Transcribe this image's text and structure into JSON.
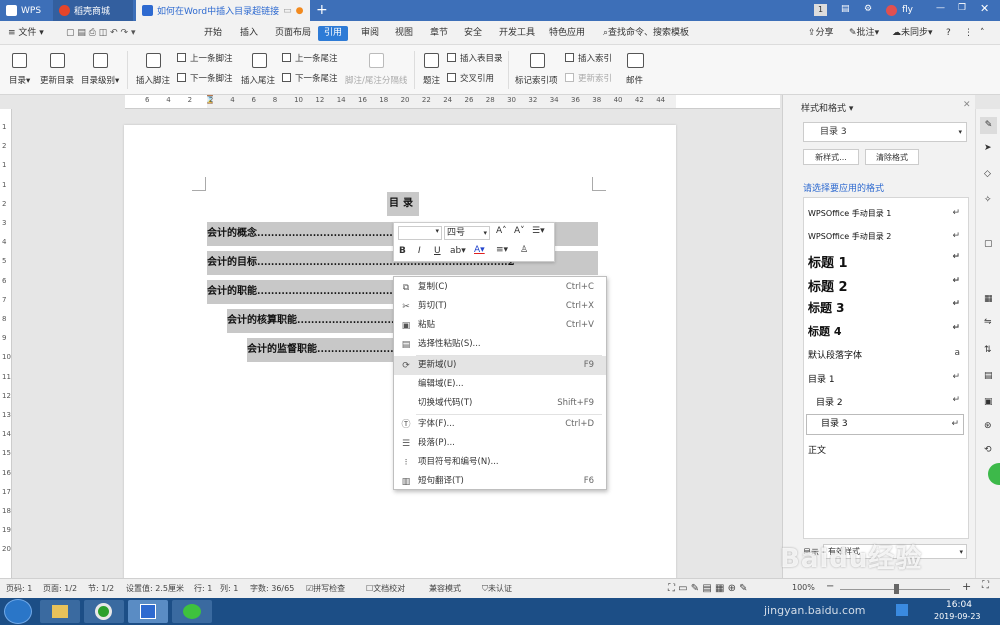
{
  "tabs": [
    {
      "label": "WPS"
    },
    {
      "label": "稻壳商城"
    },
    {
      "label": "如何在Word中插入目录超链接"
    }
  ],
  "window_right": {
    "badge": "1",
    "user": "fly"
  },
  "menus": [
    "文件",
    "开始",
    "插入",
    "页面布局",
    "引用",
    "审阅",
    "视图",
    "章节",
    "安全",
    "开发工具",
    "特色应用"
  ],
  "search_label": "查找命令、搜索模板",
  "menu_right": [
    "分享",
    "批注",
    "未同步"
  ],
  "ribbon": {
    "big": [
      "目录",
      "更新目录",
      "目录级别",
      "插入脚注",
      "插入尾注",
      "题注",
      "标记索引项",
      "邮件"
    ],
    "small": [
      "上一条脚注",
      "下一条脚注",
      "上一条尾注",
      "下一条尾注",
      "脚注/尾注分隔线",
      "插入表目录",
      "交叉引用",
      "插入索引",
      "更新索引"
    ]
  },
  "hruler": [
    "6",
    "4",
    "2",
    "2",
    "4",
    "6",
    "8",
    "10",
    "12",
    "14",
    "16",
    "18",
    "20",
    "22",
    "24",
    "26",
    "28",
    "30",
    "32",
    "34",
    "36",
    "38",
    "40",
    "42",
    "44"
  ],
  "vruler": [
    "1",
    "2",
    "1",
    "1",
    "2",
    "3",
    "4",
    "5",
    "6",
    "7",
    "8",
    "9",
    "10",
    "11",
    "12",
    "13",
    "14",
    "15",
    "16",
    "17",
    "18",
    "19",
    "20"
  ],
  "doc": {
    "title": "目录",
    "toc": [
      {
        "text": "会计的概念........................................................................2",
        "level": 1
      },
      {
        "text": "会计的目标........................................................................2",
        "level": 1
      },
      {
        "text": "会计的职能..........................................................",
        "level": 1
      },
      {
        "text": "会计的核算职能...................................................",
        "level": 2
      },
      {
        "text": "会计的监督职能..........................................",
        "level": 3
      }
    ]
  },
  "minitb": {
    "font": "",
    "size": "四号",
    "buttons": [
      "B",
      "I",
      "U"
    ]
  },
  "context_menu": [
    {
      "label": "复制(C)",
      "shortcut": "Ctrl+C",
      "icon": "copy-icon"
    },
    {
      "label": "剪切(T)",
      "shortcut": "Ctrl+X",
      "icon": "scissors-icon"
    },
    {
      "label": "粘贴",
      "shortcut": "Ctrl+V",
      "icon": "paste-icon"
    },
    {
      "label": "选择性粘贴(S)...",
      "shortcut": "",
      "icon": "paste-special-icon"
    },
    {
      "label": "更新域(U)",
      "shortcut": "F9",
      "icon": "update-field-icon"
    },
    {
      "label": "编辑域(E)...",
      "shortcut": "",
      "icon": ""
    },
    {
      "label": "切换域代码(T)",
      "shortcut": "Shift+F9",
      "icon": ""
    },
    {
      "label": "字体(F)...",
      "shortcut": "Ctrl+D",
      "icon": "font-icon"
    },
    {
      "label": "段落(P)...",
      "shortcut": "",
      "icon": "paragraph-icon"
    },
    {
      "label": "项目符号和编号(N)...",
      "shortcut": "",
      "icon": "list-icon"
    },
    {
      "label": "短句翻译(T)",
      "shortcut": "F6",
      "icon": "translate-icon"
    }
  ],
  "panel": {
    "header": "样式和格式",
    "current": "目录 3",
    "btn_new": "新样式...",
    "btn_clear": "清除格式",
    "prompt": "请选择要应用的格式",
    "styles": [
      {
        "label": "WPSOffice 手动目录 1",
        "mark": "↵"
      },
      {
        "label": "WPSOffice 手动目录 2",
        "mark": "↵"
      },
      {
        "label": "标题 1",
        "mark": "↵"
      },
      {
        "label": "标题 2",
        "mark": "↵"
      },
      {
        "label": "标题 3",
        "mark": "↵"
      },
      {
        "label": "标题 4",
        "mark": "↵"
      },
      {
        "label": "默认段落字体",
        "mark": "a"
      },
      {
        "label": "目录 1",
        "mark": "↵"
      },
      {
        "label": "目录 2",
        "mark": "↵"
      },
      {
        "label": "目录 3",
        "mark": "↵"
      },
      {
        "label": "正文",
        "mark": ""
      }
    ],
    "show": "显示",
    "show_value": "有效样式"
  },
  "status": [
    "页码: 1",
    "页面: 1/2",
    "节: 1/2",
    "设置值: 2.5厘米",
    "行: 1",
    "列: 1",
    "字数: 36/65",
    "拼写检查",
    "文档校对",
    "兼容模式",
    "未认证"
  ],
  "zoom": "100%",
  "clock": {
    "time": "16:04",
    "date": "2019-09-23"
  },
  "watermark": {
    "brand": "Baidu经验",
    "url": "jingyan.baidu.com"
  }
}
